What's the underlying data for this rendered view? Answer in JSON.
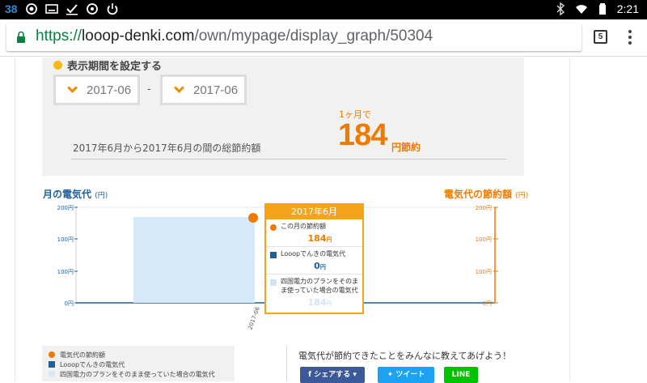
{
  "status_bar": {
    "left_number": "38",
    "time": "2:21",
    "icons": [
      "lens-icon",
      "media-icon",
      "check-icon",
      "circle-icon",
      "power-icon"
    ],
    "right_icons": [
      "bluetooth-icon",
      "wifi-icon",
      "battery-icon"
    ]
  },
  "browser": {
    "url_scheme": "https://",
    "url_host": "looop-denki.com",
    "url_path": "/own/mypage/display_graph/50304",
    "tab_count": "5"
  },
  "period": {
    "title": "表示期間を設定する",
    "from": "2017-06",
    "to": "2017-06",
    "separator": "-",
    "summary_label": "2017年6月から2017年6月の間の総節約額",
    "savings_prefix": "1ヶ月で",
    "savings_value": "184",
    "savings_suffix": "円節約"
  },
  "chart_data": {
    "type": "bar",
    "categories": [
      "2017-06"
    ],
    "series": [
      {
        "name": "Looopでんきの電気代",
        "values": [
          0
        ]
      },
      {
        "name": "四国電力のプランをそのまま使っていた場合の電気代",
        "values": [
          184
        ]
      },
      {
        "name": "この月の節約額",
        "values": [
          184
        ]
      }
    ],
    "left_axis_title": "月の電気代",
    "left_axis_unit": "(円)",
    "right_axis_title": "電気代の節約額",
    "right_axis_unit": "(円)",
    "ylim": [
      0,
      200
    ],
    "yticks_left": [
      "200円",
      "100円",
      "100円",
      "0円"
    ],
    "yticks_right": [
      "200円",
      "100円",
      "100円",
      "0円"
    ],
    "colors": {
      "looop": "#1f5f9b",
      "shikoku": "#d6e9f8",
      "savings": "#ee7b00"
    }
  },
  "tooltip": {
    "title": "2017年6月",
    "rows": [
      {
        "label": "この月の節約額",
        "value": "184",
        "unit": "円",
        "color": "#ee7b00"
      },
      {
        "label": "Looopでんきの電気代",
        "value": "0",
        "unit": "円",
        "color": "#1f5f9b"
      },
      {
        "label": "四国電力のプランをそのまま使っていた場合の電気代",
        "value": "184",
        "unit": "円",
        "color": "#cfe5f7"
      }
    ]
  },
  "legend": {
    "items": [
      {
        "label": "電気代の節約額",
        "color": "#ee7b00"
      },
      {
        "label": "Looopでんきの電気代",
        "color": "#1f5f9b"
      },
      {
        "label": "四国電力のプランをそのまま使っていた場合の電気代",
        "color": "#d6e9f8"
      }
    ]
  },
  "share": {
    "title": "電気代が節約できたことをみんなに教えてあげよう！",
    "facebook": "シェアする",
    "twitter": "ツイート",
    "line": "LINE"
  }
}
